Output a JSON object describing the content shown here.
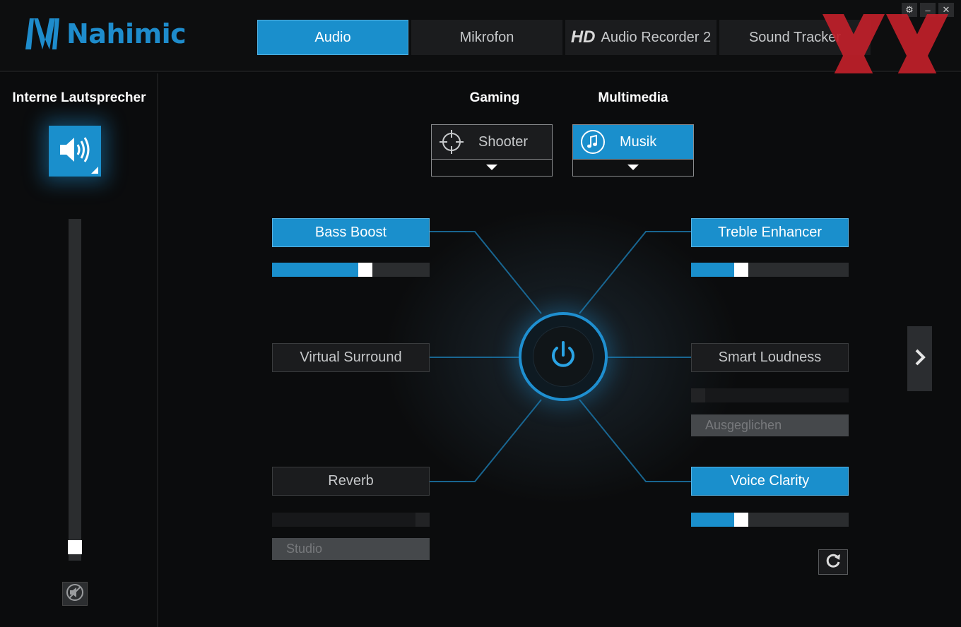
{
  "app": {
    "logo_text": "Nahimic"
  },
  "tabs": [
    {
      "label": "Audio",
      "active": true
    },
    {
      "label": "Mikrofon",
      "active": false
    },
    {
      "prefix": "HD",
      "label": "Audio Recorder 2",
      "active": false
    },
    {
      "label": "Sound Tracker",
      "active": false
    }
  ],
  "sidebar": {
    "device_title": "Interne Lautsprecher",
    "device_icon": "speaker-icon",
    "volume_level": 0.02,
    "mute_icon": "mute-icon"
  },
  "presets": {
    "gaming": {
      "label": "Gaming",
      "value": "Shooter",
      "icon": "crosshair-icon",
      "active": false
    },
    "multimedia": {
      "label": "Multimedia",
      "value": "Musik",
      "icon": "music-note-icon",
      "active": true
    }
  },
  "effects": {
    "bass_boost": {
      "label": "Bass Boost",
      "enabled": true,
      "level": 0.6
    },
    "treble_enhancer": {
      "label": "Treble Enhancer",
      "enabled": true,
      "level": 0.3
    },
    "virtual_surround": {
      "label": "Virtual Surround",
      "enabled": false
    },
    "smart_loudness": {
      "label": "Smart Loudness",
      "enabled": false,
      "mode": "Ausgeglichen"
    },
    "reverb": {
      "label": "Reverb",
      "enabled": false,
      "mode": "Studio"
    },
    "voice_clarity": {
      "label": "Voice Clarity",
      "enabled": true,
      "level": 0.3
    }
  },
  "colors": {
    "accent": "#1a8fcc",
    "background": "#0b0c0d",
    "watermark": "#c0202a"
  }
}
